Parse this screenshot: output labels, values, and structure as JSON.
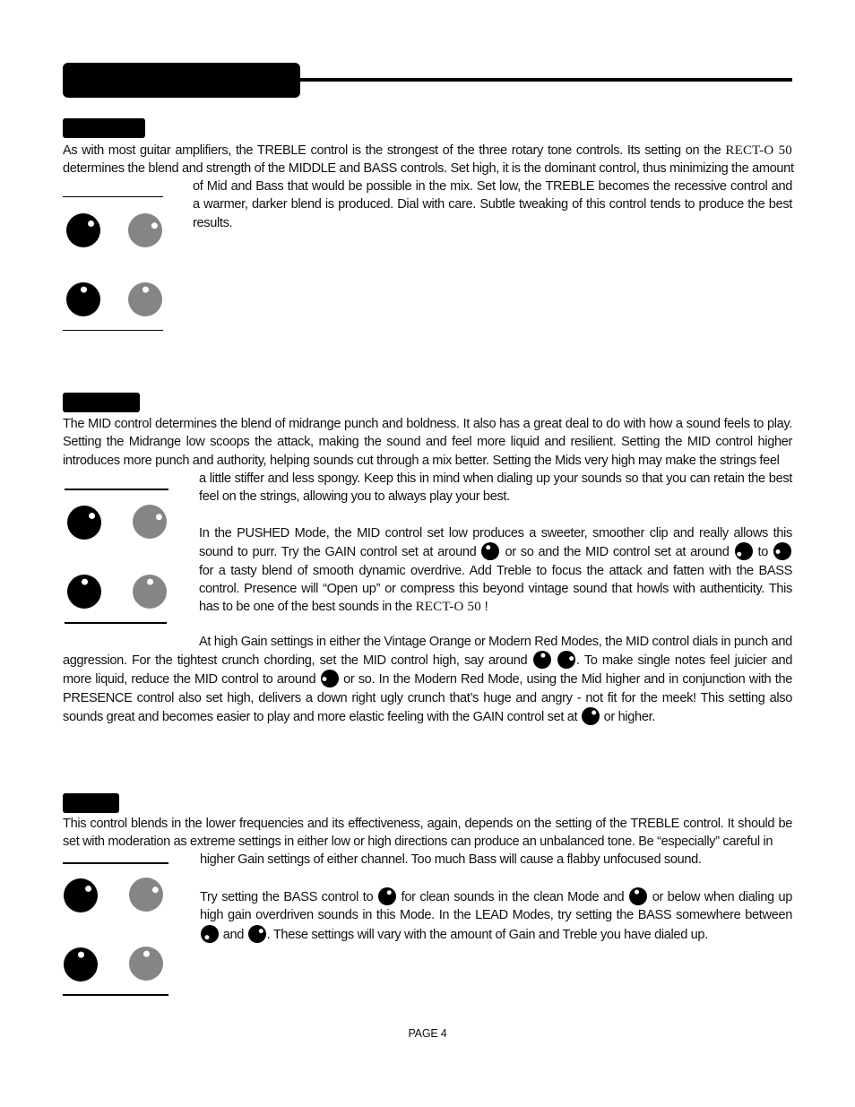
{
  "page": {
    "brand_name": "RECT-O 50",
    "page_number": "PAGE 4"
  },
  "treble": {
    "lines": [
      [
        "As with most guitar amplifiers, the TREBLE control is the strongest of the three rotary tone controls. Its setting on the ",
        {
          "brand": "RECT-O 50"
        }
      ],
      [
        "determines the blend and strength of the MIDDLE and BASS controls. Set high, it is the dominant control, thus minimizing the amount"
      ],
      [
        "of Mid and Bass that would be possible in the mix. Set low, the TREBLE becomes the recessive control and"
      ],
      [
        "a warmer, darker blend is produced. Dial with care. Subtle tweaking of this control tends to produce the best"
      ],
      [
        "results."
      ]
    ],
    "knob_diagram": [
      {
        "color": "black",
        "pointer_deg": -45
      },
      {
        "color": "gray",
        "pointer_deg": -30
      },
      {
        "color": "black",
        "pointer_deg": -90
      },
      {
        "color": "gray",
        "pointer_deg": -90
      }
    ]
  },
  "mid": {
    "intro_lines": [
      [
        "The MID control determines the blend of midrange punch and boldness. It also has a great deal to do with how a sound feels to play."
      ],
      [
        "Setting the Midrange low scoops the attack, making the sound and feel more liquid and resilient. Setting the MID control higher"
      ],
      [
        "introduces more punch and authority, helping sounds cut through a mix better. Setting the Mids very high may make the strings feel"
      ],
      [
        "a little stiffer and less spongy. Keep this in mind when dialing up your sounds so that you can retain the best"
      ],
      [
        "feel on the strings, allowing you to always play your best."
      ]
    ],
    "pushed_lines": [
      [
        "In the PUSHED Mode, the MID control set low produces a sweeter, smoother clip and really allows this"
      ],
      [
        "sound to purr.  Try the GAIN control set at around ",
        {
          "knob": -120
        },
        " or so and the MID control set at around ",
        {
          "knob": -210
        },
        " to ",
        {
          "knob": -180
        }
      ],
      [
        "for a tasty blend of smooth dynamic overdrive. Add Treble to focus the attack and fatten with the BASS"
      ],
      [
        "control. Presence will “Open up” or compress this beyond vintage sound that howls with authenticity. This"
      ],
      [
        "has to be one of the best sounds in the ",
        {
          "brand": "RECT-O 50"
        },
        " !"
      ]
    ],
    "high_gain_lines": [
      [
        "At high Gain settings in either the Vintage Orange or Modern Red Modes, the MID control dials in punch and"
      ],
      [
        "aggression. For the tightest crunch chording, set the MID control high, say around ",
        {
          "knob": -75
        },
        " ",
        {
          "knob": -20
        },
        ".  To make single notes feel juicier and"
      ],
      [
        "more liquid, reduce the MID control to around ",
        {
          "knob": -180
        },
        " or so. In the Modern Red Mode, using the Mid higher and in conjunction with the"
      ],
      [
        "PRESENCE control also set high, delivers a down right ugly crunch that’s huge and angry - not fit for the meek!  This setting also"
      ],
      [
        "sounds great and becomes easier to play and more elastic feeling with the GAIN control set at ",
        {
          "knob": -40
        },
        " or higher."
      ]
    ],
    "knob_diagram": [
      {
        "color": "black",
        "pointer_deg": -45
      },
      {
        "color": "gray",
        "pointer_deg": -30
      },
      {
        "color": "black",
        "pointer_deg": -90
      },
      {
        "color": "gray",
        "pointer_deg": -90
      }
    ]
  },
  "bass": {
    "intro_lines": [
      [
        "This control blends in the lower frequencies and its effectiveness, again, depends on the setting of the TREBLE control. It should be"
      ],
      [
        "set with moderation as extreme settings in either low or high directions can produce an unbalanced tone. Be “especially” careful in"
      ],
      [
        "higher Gain settings of either channel. Too much Bass will cause a flabby unfocused sound."
      ]
    ],
    "tips_lines": [
      [
        "Try setting the BASS control to ",
        {
          "knob": -60
        },
        " for clean sounds in the clean Mode and ",
        {
          "knob": -100
        },
        " or below when dialing up"
      ],
      [
        "high gain overdriven sounds in this Mode. In the LEAD Modes, try setting the BASS somewhere between"
      ],
      [
        "",
        {
          "knob": -230
        },
        " and ",
        {
          "knob": -30
        },
        ".  These settings will vary with the amount of Gain and Treble you have dialed up."
      ]
    ],
    "knob_diagram": [
      {
        "color": "black",
        "pointer_deg": -45
      },
      {
        "color": "gray",
        "pointer_deg": -30
      },
      {
        "color": "black",
        "pointer_deg": -90
      },
      {
        "color": "gray",
        "pointer_deg": -90
      }
    ]
  }
}
